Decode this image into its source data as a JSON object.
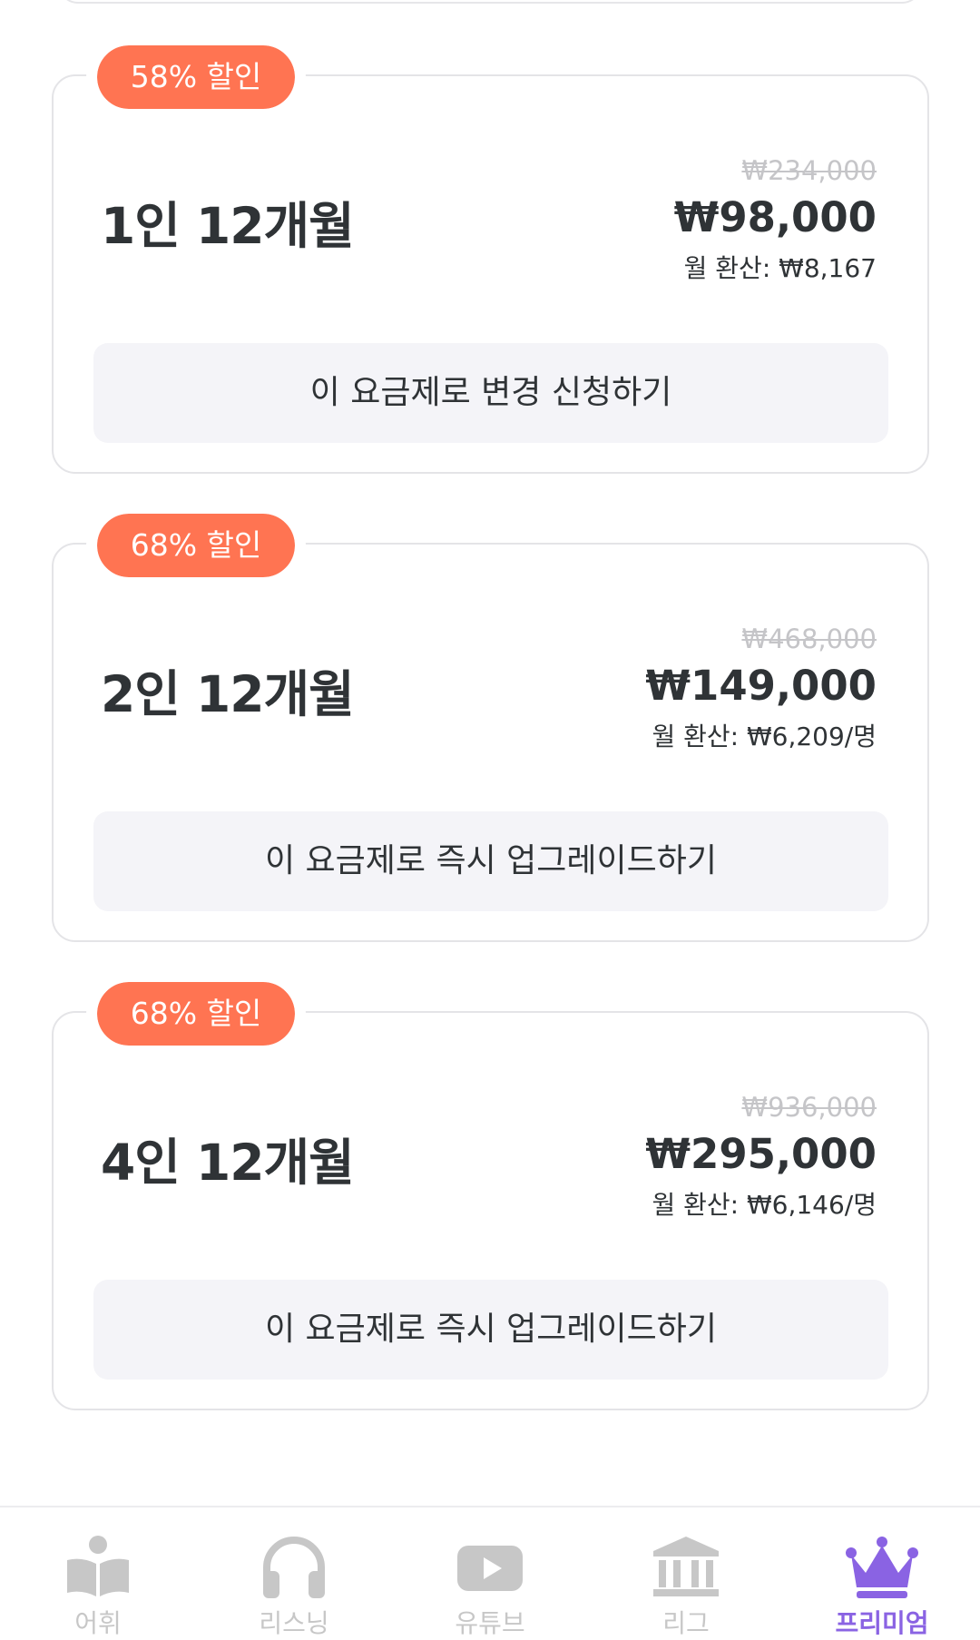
{
  "plans": [
    {
      "discount": "58% 할인",
      "name": "1인 12개월",
      "original_price": "₩234,000",
      "sale_price": "₩98,000",
      "monthly_price": "월 환산: ₩8,167",
      "button_label": "이 요금제로 변경 신청하기"
    },
    {
      "discount": "68% 할인",
      "name": "2인 12개월",
      "original_price": "₩468,000",
      "sale_price": "₩149,000",
      "monthly_price": "월 환산: ₩6,209/명",
      "button_label": "이 요금제로 즉시 업그레이드하기"
    },
    {
      "discount": "68% 할인",
      "name": "4인 12개월",
      "original_price": "₩936,000",
      "sale_price": "₩295,000",
      "monthly_price": "월 환산: ₩6,146/명",
      "button_label": "이 요금제로 즉시 업그레이드하기"
    }
  ],
  "bottom_nav": [
    {
      "label": "어휘",
      "icon": "book-reader-icon"
    },
    {
      "label": "리스닝",
      "icon": "headphones-icon"
    },
    {
      "label": "유튜브",
      "icon": "youtube-play-icon"
    },
    {
      "label": "리그",
      "icon": "institution-icon"
    },
    {
      "label": "프리미엄",
      "icon": "crown-icon",
      "active": true
    }
  ],
  "colors": {
    "badge": "#ff7452",
    "active_nav": "#8a63e3",
    "inactive_nav": "#c7c7c7",
    "button_bg": "#f4f4f8",
    "card_border": "#e4e4e7",
    "text": "#2f3336"
  }
}
